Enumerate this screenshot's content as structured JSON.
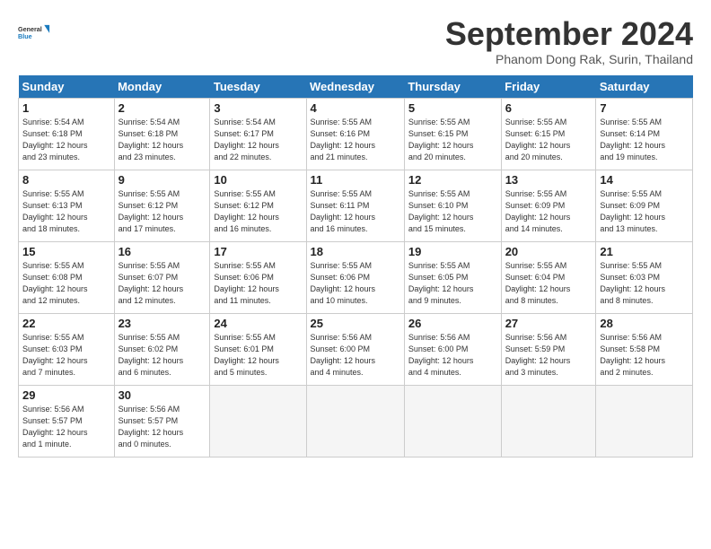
{
  "header": {
    "logo_line1": "General",
    "logo_line2": "Blue",
    "month_title": "September 2024",
    "location": "Phanom Dong Rak, Surin, Thailand"
  },
  "weekdays": [
    "Sunday",
    "Monday",
    "Tuesday",
    "Wednesday",
    "Thursday",
    "Friday",
    "Saturday"
  ],
  "weeks": [
    [
      {
        "day": "1",
        "info": "Sunrise: 5:54 AM\nSunset: 6:18 PM\nDaylight: 12 hours\nand 23 minutes."
      },
      {
        "day": "2",
        "info": "Sunrise: 5:54 AM\nSunset: 6:18 PM\nDaylight: 12 hours\nand 23 minutes."
      },
      {
        "day": "3",
        "info": "Sunrise: 5:54 AM\nSunset: 6:17 PM\nDaylight: 12 hours\nand 22 minutes."
      },
      {
        "day": "4",
        "info": "Sunrise: 5:55 AM\nSunset: 6:16 PM\nDaylight: 12 hours\nand 21 minutes."
      },
      {
        "day": "5",
        "info": "Sunrise: 5:55 AM\nSunset: 6:15 PM\nDaylight: 12 hours\nand 20 minutes."
      },
      {
        "day": "6",
        "info": "Sunrise: 5:55 AM\nSunset: 6:15 PM\nDaylight: 12 hours\nand 20 minutes."
      },
      {
        "day": "7",
        "info": "Sunrise: 5:55 AM\nSunset: 6:14 PM\nDaylight: 12 hours\nand 19 minutes."
      }
    ],
    [
      {
        "day": "8",
        "info": "Sunrise: 5:55 AM\nSunset: 6:13 PM\nDaylight: 12 hours\nand 18 minutes."
      },
      {
        "day": "9",
        "info": "Sunrise: 5:55 AM\nSunset: 6:12 PM\nDaylight: 12 hours\nand 17 minutes."
      },
      {
        "day": "10",
        "info": "Sunrise: 5:55 AM\nSunset: 6:12 PM\nDaylight: 12 hours\nand 16 minutes."
      },
      {
        "day": "11",
        "info": "Sunrise: 5:55 AM\nSunset: 6:11 PM\nDaylight: 12 hours\nand 16 minutes."
      },
      {
        "day": "12",
        "info": "Sunrise: 5:55 AM\nSunset: 6:10 PM\nDaylight: 12 hours\nand 15 minutes."
      },
      {
        "day": "13",
        "info": "Sunrise: 5:55 AM\nSunset: 6:09 PM\nDaylight: 12 hours\nand 14 minutes."
      },
      {
        "day": "14",
        "info": "Sunrise: 5:55 AM\nSunset: 6:09 PM\nDaylight: 12 hours\nand 13 minutes."
      }
    ],
    [
      {
        "day": "15",
        "info": "Sunrise: 5:55 AM\nSunset: 6:08 PM\nDaylight: 12 hours\nand 12 minutes."
      },
      {
        "day": "16",
        "info": "Sunrise: 5:55 AM\nSunset: 6:07 PM\nDaylight: 12 hours\nand 12 minutes."
      },
      {
        "day": "17",
        "info": "Sunrise: 5:55 AM\nSunset: 6:06 PM\nDaylight: 12 hours\nand 11 minutes."
      },
      {
        "day": "18",
        "info": "Sunrise: 5:55 AM\nSunset: 6:06 PM\nDaylight: 12 hours\nand 10 minutes."
      },
      {
        "day": "19",
        "info": "Sunrise: 5:55 AM\nSunset: 6:05 PM\nDaylight: 12 hours\nand 9 minutes."
      },
      {
        "day": "20",
        "info": "Sunrise: 5:55 AM\nSunset: 6:04 PM\nDaylight: 12 hours\nand 8 minutes."
      },
      {
        "day": "21",
        "info": "Sunrise: 5:55 AM\nSunset: 6:03 PM\nDaylight: 12 hours\nand 8 minutes."
      }
    ],
    [
      {
        "day": "22",
        "info": "Sunrise: 5:55 AM\nSunset: 6:03 PM\nDaylight: 12 hours\nand 7 minutes."
      },
      {
        "day": "23",
        "info": "Sunrise: 5:55 AM\nSunset: 6:02 PM\nDaylight: 12 hours\nand 6 minutes."
      },
      {
        "day": "24",
        "info": "Sunrise: 5:55 AM\nSunset: 6:01 PM\nDaylight: 12 hours\nand 5 minutes."
      },
      {
        "day": "25",
        "info": "Sunrise: 5:56 AM\nSunset: 6:00 PM\nDaylight: 12 hours\nand 4 minutes."
      },
      {
        "day": "26",
        "info": "Sunrise: 5:56 AM\nSunset: 6:00 PM\nDaylight: 12 hours\nand 4 minutes."
      },
      {
        "day": "27",
        "info": "Sunrise: 5:56 AM\nSunset: 5:59 PM\nDaylight: 12 hours\nand 3 minutes."
      },
      {
        "day": "28",
        "info": "Sunrise: 5:56 AM\nSunset: 5:58 PM\nDaylight: 12 hours\nand 2 minutes."
      }
    ],
    [
      {
        "day": "29",
        "info": "Sunrise: 5:56 AM\nSunset: 5:57 PM\nDaylight: 12 hours\nand 1 minute."
      },
      {
        "day": "30",
        "info": "Sunrise: 5:56 AM\nSunset: 5:57 PM\nDaylight: 12 hours\nand 0 minutes."
      },
      {
        "day": "",
        "info": ""
      },
      {
        "day": "",
        "info": ""
      },
      {
        "day": "",
        "info": ""
      },
      {
        "day": "",
        "info": ""
      },
      {
        "day": "",
        "info": ""
      }
    ]
  ]
}
